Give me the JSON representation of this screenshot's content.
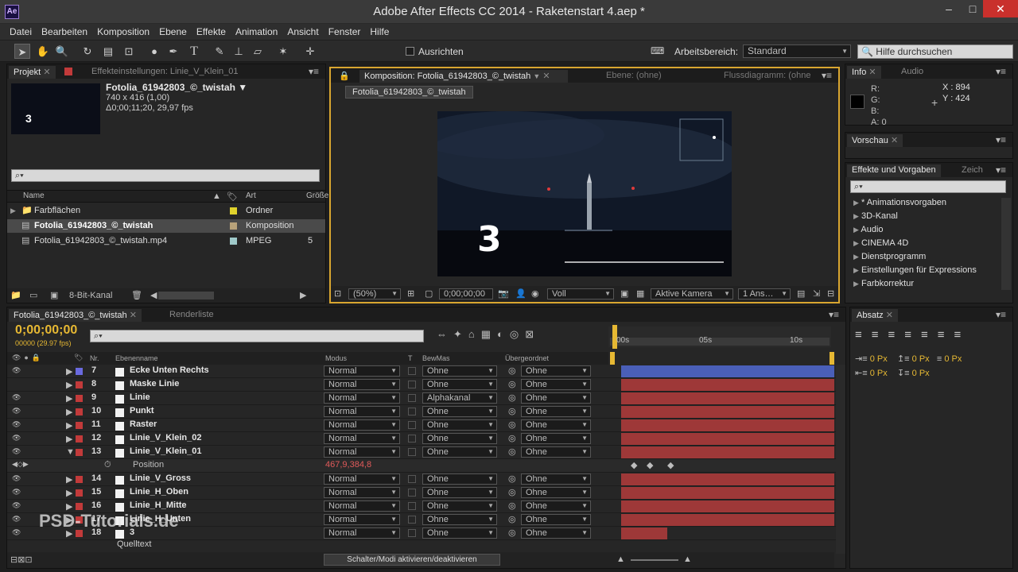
{
  "window": {
    "title": "Adobe After Effects CC 2014 - Raketenstart 4.aep *",
    "app_icon": "Ae",
    "minimize": "–",
    "restore": "□",
    "close": "✕"
  },
  "menu": [
    "Datei",
    "Bearbeiten",
    "Komposition",
    "Ebene",
    "Effekte",
    "Animation",
    "Ansicht",
    "Fenster",
    "Hilfe"
  ],
  "toolbar": {
    "snap_label": "Ausrichten",
    "workspace_label": "Arbeitsbereich:",
    "workspace_value": "Standard",
    "help_placeholder": "Hilfe durchsuchen"
  },
  "project": {
    "tab_label": "Projekt",
    "tab2_label": "Effekteinstellungen: Linie_V_Klein_01",
    "item_name": "Fotolia_61942803_©_twistah ▼",
    "item_size": "740 x 416 (1,00)",
    "item_duration": "Δ0;00;11;20, 29,97 fps",
    "thumb_text": "3",
    "search_placeholder": "",
    "col_name": "Name",
    "col_type": "Art",
    "col_size": "Größe",
    "items": [
      {
        "name": "Farbflächen",
        "type": "Ordner",
        "size": "",
        "color": "#e0d22c"
      },
      {
        "name": "Fotolia_61942803_©_twistah",
        "type": "Komposition",
        "size": "",
        "color": "#b8a27a"
      },
      {
        "name": "Fotolia_61942803_©_twistah.mp4",
        "type": "MPEG",
        "size": "5",
        "color": "#9fc9c9"
      }
    ],
    "bit_depth": "8-Bit-Kanal"
  },
  "composition": {
    "tab_label": "Komposition: Fotolia_61942803_©_twistah",
    "layer_tab": "Ebene: (ohne)",
    "flow_tab": "Flussdiagramm: (ohne",
    "breadcrumb": "Fotolia_61942803_©_twistah",
    "countdown": "3",
    "zoom": "(50%)",
    "timecode": "0;00;00;00",
    "resolution": "Voll",
    "camera": "Aktive Kamera",
    "views": "1 Ans…"
  },
  "info": {
    "tab_label": "Info",
    "audio_tab": "Audio",
    "r": "R:",
    "g": "G:",
    "b": "B:",
    "a": "A:  0",
    "x": "X : 894",
    "y": "Y : 424"
  },
  "preview": {
    "tab_label": "Vorschau"
  },
  "effects": {
    "tab_label": "Effekte und Vorgaben",
    "tab2_label": "Zeich",
    "items": [
      "* Animationsvorgaben",
      "3D-Kanal",
      "Audio",
      "CINEMA 4D",
      "Dienstprogramm",
      "Einstellungen für Expressions",
      "Farbkorrektur"
    ]
  },
  "absatz": {
    "tab_label": "Absatz",
    "px_values": [
      "0 Px",
      "0 Px",
      "0 Px",
      "0 Px",
      "0 Px"
    ]
  },
  "timeline": {
    "tab_label": "Fotolia_61942803_©_twistah",
    "render_tab": "Renderliste",
    "timecode": "0;00;00;00",
    "fps": "00000 (29.97 fps)",
    "col_nr": "Nr.",
    "col_name": "Ebenenname",
    "col_mode": "Modus",
    "col_t": "T",
    "col_track": "BewMas",
    "col_parent": "Übergeordnet",
    "ruler": [
      "00s",
      "05s",
      "10s"
    ],
    "position_label": "Position",
    "position_value": "467,9,384,8",
    "quelltext": "Quelltext",
    "toggle_label": "Schalter/Modi aktivieren/deaktivieren",
    "watermark": "PSD-Tutorials.de",
    "layers": [
      {
        "nr": "7",
        "name": "Ecke Unten Rechts",
        "mode": "Normal",
        "track": "Ohne",
        "parent": "Ohne",
        "color": "#6a6adf",
        "bar": "#4a5fb8"
      },
      {
        "nr": "8",
        "name": "Maske Linie",
        "mode": "Normal",
        "track": "Ohne",
        "parent": "Ohne",
        "color": "#c23a3a",
        "bar": "#9e3838"
      },
      {
        "nr": "9",
        "name": "Linie",
        "mode": "Normal",
        "track": "Alphakanal",
        "parent": "Ohne",
        "color": "#c23a3a",
        "bar": "#9e3838"
      },
      {
        "nr": "10",
        "name": "Punkt",
        "mode": "Normal",
        "track": "Ohne",
        "parent": "Ohne",
        "color": "#c23a3a",
        "bar": "#9e3838"
      },
      {
        "nr": "11",
        "name": "Raster",
        "mode": "Normal",
        "track": "Ohne",
        "parent": "Ohne",
        "color": "#c23a3a",
        "bar": "#9e3838"
      },
      {
        "nr": "12",
        "name": "Linie_V_Klein_02",
        "mode": "Normal",
        "track": "Ohne",
        "parent": "Ohne",
        "color": "#c23a3a",
        "bar": "#9e3838"
      },
      {
        "nr": "13",
        "name": "Linie_V_Klein_01",
        "mode": "Normal",
        "track": "Ohne",
        "parent": "Ohne",
        "color": "#c23a3a",
        "bar": "#9e3838"
      },
      {
        "nr": "14",
        "name": "Linie_V_Gross",
        "mode": "Normal",
        "track": "Ohne",
        "parent": "Ohne",
        "color": "#c23a3a",
        "bar": "#9e3838"
      },
      {
        "nr": "15",
        "name": "Linie_H_Oben",
        "mode": "Normal",
        "track": "Ohne",
        "parent": "Ohne",
        "color": "#c23a3a",
        "bar": "#9e3838"
      },
      {
        "nr": "16",
        "name": "Linie_H_Mitte",
        "mode": "Normal",
        "track": "Ohne",
        "parent": "Ohne",
        "color": "#c23a3a",
        "bar": "#9e3838"
      },
      {
        "nr": "17",
        "name": "Linie_H_Unten",
        "mode": "Normal",
        "track": "Ohne",
        "parent": "Ohne",
        "color": "#c23a3a",
        "bar": "#9e3838"
      },
      {
        "nr": "18",
        "name": "3",
        "mode": "Normal",
        "track": "Ohne",
        "parent": "Ohne",
        "color": "#c23a3a",
        "bar": "#9e3838"
      }
    ]
  }
}
